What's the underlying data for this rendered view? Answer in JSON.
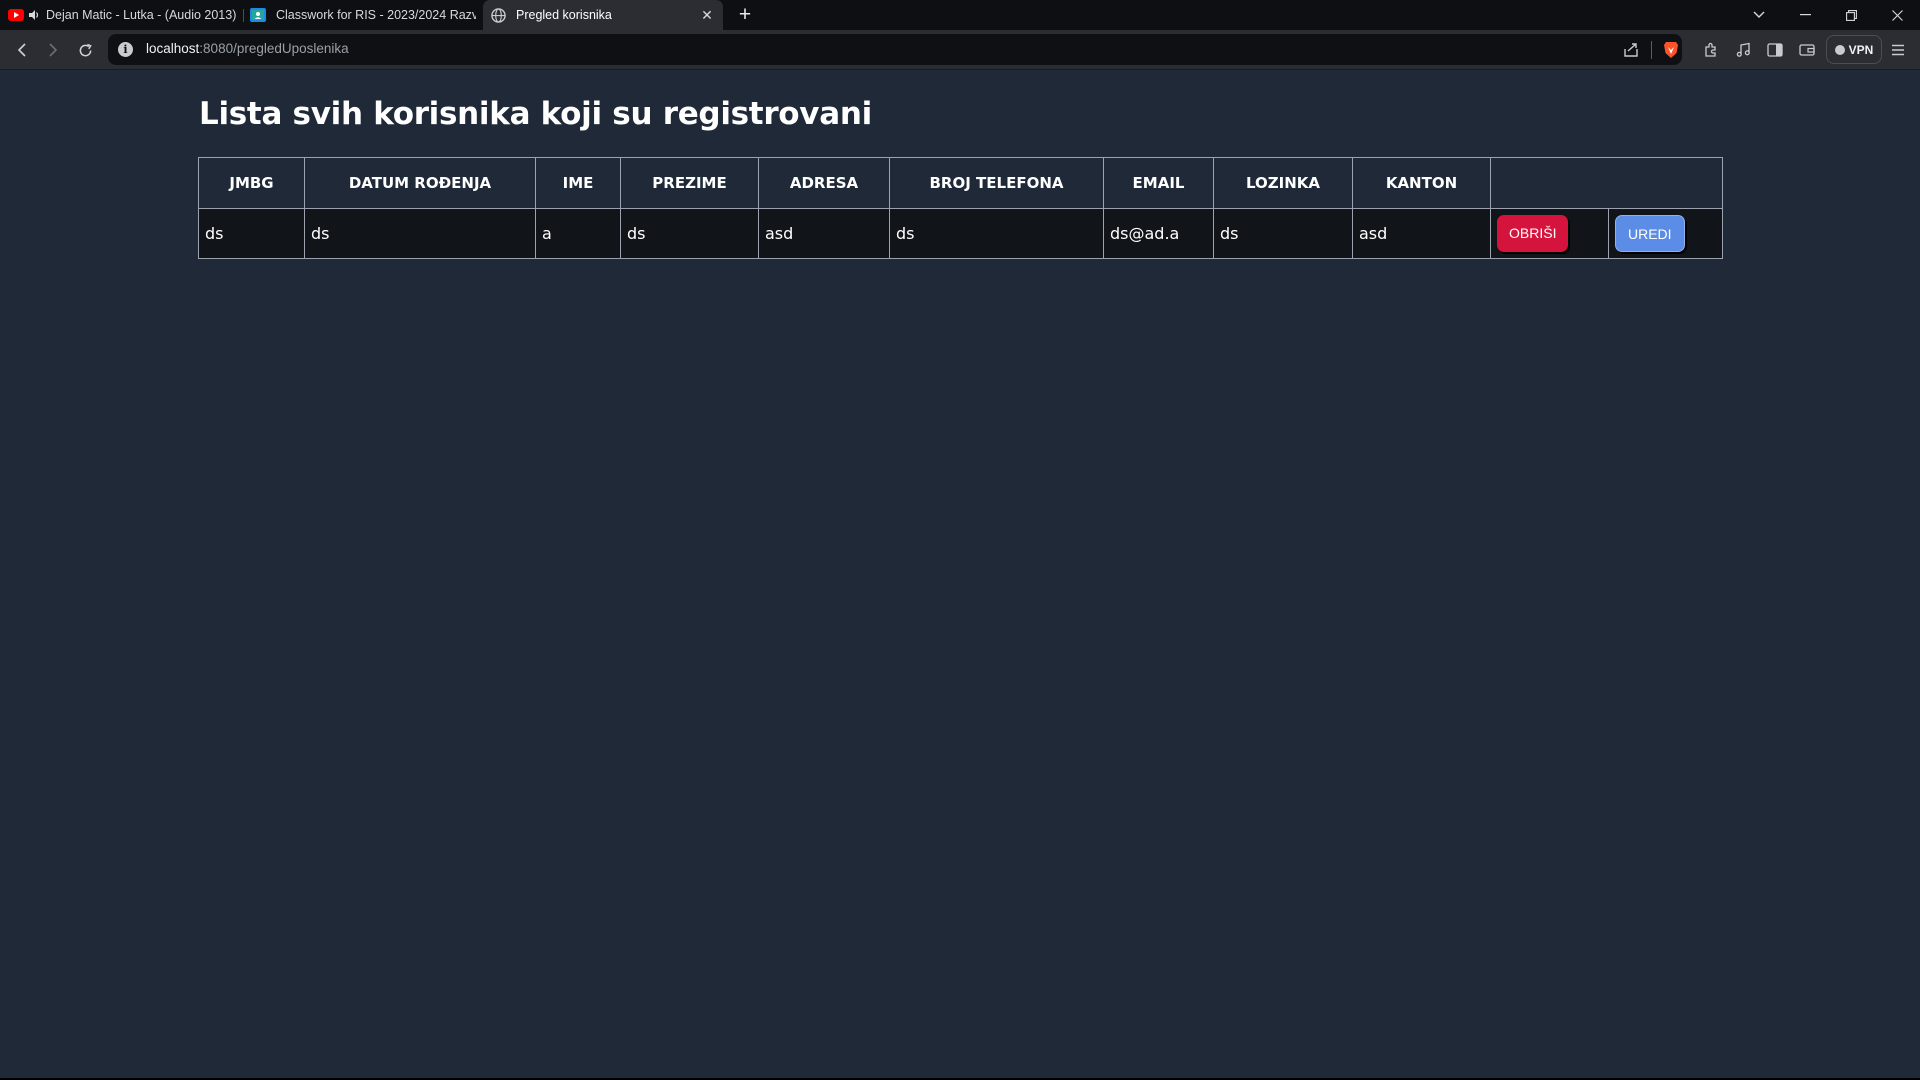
{
  "browser": {
    "tabs": [
      {
        "title": "Dejan Matic - Lutka - (Audio 2013)",
        "icon": "youtube-icon",
        "audio": true
      },
      {
        "title": "Classwork for RIS - 2023/2024 Razvoj",
        "icon": "classroom-icon"
      },
      {
        "title": "Pregled korisnika",
        "icon": "globe-icon",
        "active": true
      }
    ],
    "url_host": "localhost",
    "url_path": ":8080/pregledUposlenika",
    "vpn_label": "VPN"
  },
  "page": {
    "title": "Lista svih korisnika koji su registrovani",
    "table": {
      "columns": [
        "JMBG",
        "DATUM ROĐENJA",
        "IME",
        "PREZIME",
        "ADRESA",
        "BROJ TELEFONA",
        "EMAIL",
        "LOZINKA",
        "KANTON",
        ""
      ],
      "rows": [
        {
          "jmbg": "ds",
          "datum_rodjenja": "ds",
          "ime": "a",
          "prezime": "ds",
          "adresa": "asd",
          "broj_telefona": "ds",
          "email": "ds@ad.a",
          "lozinka": "ds",
          "kanton": "asd"
        }
      ],
      "delete_label": "OBRIŠI",
      "edit_label": "UREDI"
    }
  },
  "colors": {
    "page_bg": "#1f2937",
    "delete_button": "#d4143c",
    "edit_button": "#5b8de6"
  }
}
